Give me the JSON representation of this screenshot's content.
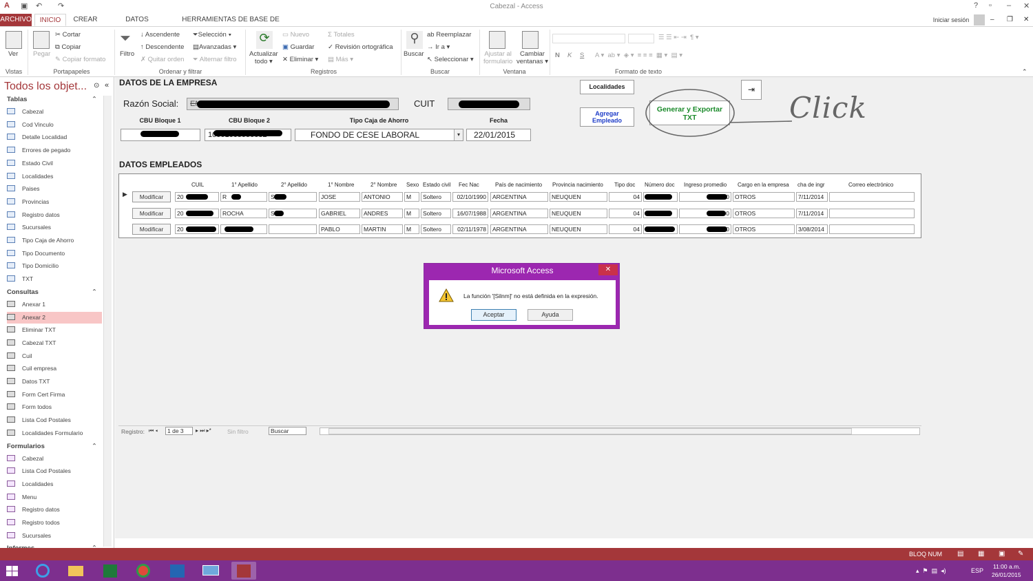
{
  "window": {
    "title": "Cabezal - Access",
    "user": "Iniciar sesión"
  },
  "ribbon_tabs": [
    "ARCHIVO",
    "INICIO",
    "CREAR",
    "DATOS EXTERNOS",
    "HERRAMIENTAS DE BASE DE DATOS"
  ],
  "ribbon": {
    "vistas": {
      "ver": "Ver",
      "group": "Vistas"
    },
    "portapapeles": {
      "pegar": "Pegar",
      "cortar": "Cortar",
      "copiar": "Copiar",
      "copiar_formato": "Copiar formato",
      "group": "Portapapeles"
    },
    "filtrar": {
      "filtro": "Filtro",
      "ascendente": "Ascendente",
      "descendente": "Descendente",
      "quitar_orden": "Quitar orden",
      "seleccion": "Selección",
      "avanzadas": "Avanzadas",
      "alternar_filtro": "Alternar filtro",
      "group": "Ordenar y filtrar"
    },
    "registros": {
      "actualizar": "Actualizar",
      "todo": "todo",
      "nuevo": "Nuevo",
      "guardar": "Guardar",
      "eliminar": "Eliminar",
      "totales": "Totales",
      "revision": "Revisión ortográfica",
      "mas": "Más",
      "group": "Registros"
    },
    "buscar": {
      "buscar": "Buscar",
      "reemplazar": "Reemplazar",
      "ir_a": "Ir a",
      "seleccionar": "Seleccionar",
      "group": "Buscar"
    },
    "ventana": {
      "ajustar": "Ajustar al",
      "formulario": "formulario",
      "cambiar": "Cambiar",
      "ventanas": "ventanas",
      "group": "Ventana"
    },
    "formato": {
      "n": "N",
      "k": "K",
      "s": "S",
      "group": "Formato de texto"
    }
  },
  "nav": {
    "title": "Todos los objet...",
    "sections": [
      {
        "name": "Tablas",
        "items": [
          "Cabezal",
          "Cod Vinculo",
          "Detalle Localidad",
          "Errores de pegado",
          "Estado Civil",
          "Localidades",
          "Paises",
          "Provincias",
          "Registro datos",
          "Sucursales",
          "Tipo Caja de Ahorro",
          "Tipo Documento",
          "Tipo Domicilio",
          "TXT"
        ]
      },
      {
        "name": "Consultas",
        "items": [
          "Anexar 1",
          "Anexar 2",
          "Eliminar TXT",
          "Cabezal TXT",
          "Cuil",
          "Cuil empresa",
          "Datos TXT",
          "Form Cert Firma",
          "Form todos",
          "Lista Cod Postales",
          "Localidades Formulario"
        ]
      },
      {
        "name": "Formularios",
        "items": [
          "Cabezal",
          "Lista Cod Postales",
          "Localidades",
          "Menu",
          "Registro datos",
          "Registro todos",
          "Sucursales"
        ]
      },
      {
        "name": "Informes",
        "items": []
      }
    ]
  },
  "form": {
    "empresa_title": "DATOS DE LA EMPRESA",
    "razon_social_label": "Razón Social:",
    "razon_social_value": "EMPRESA CONSTRUCTORA LAUTEC SRL",
    "cuit_label": "CUIT",
    "cbu1_label": "CBU Bloque 1",
    "cbu2_label": "CBU Bloque 2",
    "cbu2_value": "10001005950032",
    "tipo_caja_label": "Tipo Caja de Ahorro",
    "tipo_caja_value": "FONDO DE CESE LABORAL",
    "fecha_label": "Fecha",
    "fecha_value": "22/01/2015",
    "localidades_button": "Localidades",
    "agregar_button": "Agregar Empleado",
    "generar_button": "Generar y Exportar TXT",
    "click_annotation": "Click",
    "empleados_title": "DATOS EMPLEADOS"
  },
  "grid": {
    "columns": [
      "CUIL",
      "1° Apellido",
      "2° Apellido",
      "1° Nombre",
      "2° Nombre",
      "Sexo",
      "Estado civil",
      "Fec Nac",
      "País de nacimiento",
      "Provincia nacimiento",
      "Tipo doc",
      "Número doc",
      "Ingreso promedio",
      "Cargo en la empresa",
      "cha de ingr",
      "Correo electrónico"
    ],
    "row_button": "Modificar",
    "rows": [
      {
        "cuil": "20",
        "ap1": "R",
        "ap2": "S",
        "n1": "JOSE",
        "n2": "ANTONIO",
        "sexo": "M",
        "civil": "Soltero",
        "fnac": "02/10/1990",
        "pais": "ARGENTINA",
        "prov": "NEUQUEN",
        "tdoc": "04",
        "ndoc": "3",
        "ingreso": "00",
        "cargo": "OTROS",
        "fing": "7/11/2014"
      },
      {
        "cuil": "20",
        "ap1": "ROCHA",
        "ap2": "S",
        "n1": "GABRIEL",
        "n2": "ANDRES",
        "sexo": "M",
        "civil": "Soltero",
        "fnac": "16/07/1988",
        "pais": "ARGENTINA",
        "prov": "NEUQUEN",
        "tdoc": "04",
        "ndoc": "3",
        "ingreso": ",00",
        "cargo": "OTROS",
        "fing": "7/11/2014"
      },
      {
        "cuil": "20",
        "ap1": "",
        "ap2": "",
        "n1": "PABLO",
        "n2": "MARTIN",
        "sexo": "M",
        "civil": "Soltero",
        "fnac": "02/11/1978",
        "pais": "ARGENTINA",
        "prov": "NEUQUEN",
        "tdoc": "04",
        "ndoc": "",
        "ingreso": ",00",
        "cargo": "OTROS",
        "fing": "3/08/2014"
      }
    ]
  },
  "recnav": {
    "label": "Registro:",
    "position": "1 de 3",
    "filter": "Sin filtro",
    "search": "Buscar"
  },
  "dialog": {
    "title": "Microsoft Access",
    "message": "La función '[Silnm]' no está definida en la expresión.",
    "ok": "Aceptar",
    "help": "Ayuda"
  },
  "status": {
    "bloq": "BLOQ NUM"
  },
  "taskbar": {
    "time": "11:00 a.m.",
    "date": "26/01/2015",
    "lang": "ESP"
  }
}
